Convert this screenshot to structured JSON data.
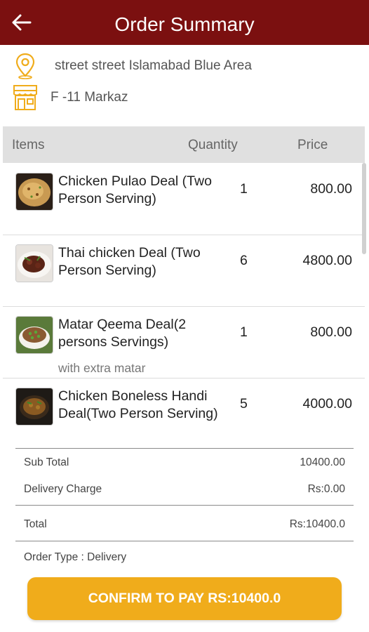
{
  "header": {
    "title": "Order Summary",
    "back_icon": "arrow-left-icon"
  },
  "colors": {
    "brand": "#7b1010",
    "accent": "#f0ac1b",
    "icon": "#f0ac1b"
  },
  "address": {
    "line1": "street street Islamabad Blue Area",
    "line1_icon": "location-pin-icon",
    "line2": "F -11 Markaz",
    "line2_icon": "store-icon"
  },
  "table": {
    "headers": {
      "items": "Items",
      "quantity": "Quantity",
      "price": "Price"
    },
    "rows": [
      {
        "name": "Chicken Pulao Deal (Two Person Serving)",
        "note": "",
        "qty": "1",
        "price": "800.00"
      },
      {
        "name": "Thai chicken Deal (Two Person Serving)",
        "note": "",
        "qty": "6",
        "price": "4800.00"
      },
      {
        "name": "Matar Qeema Deal(2 persons Servings)",
        "note": "with extra matar",
        "qty": "1",
        "price": "800.00"
      },
      {
        "name": "Chicken Boneless Handi Deal(Two Person Serving)",
        "note": "",
        "qty": "5",
        "price": "4000.00"
      }
    ]
  },
  "summary": {
    "subtotal_label": "Sub Total",
    "subtotal_value": "10400.00",
    "delivery_label": "Delivery Charge",
    "delivery_value": "Rs:0.00",
    "total_label": "Total",
    "total_value": "Rs:10400.0",
    "order_type": "Order Type : Delivery"
  },
  "confirm_label": "CONFIRM TO PAY RS:10400.0"
}
